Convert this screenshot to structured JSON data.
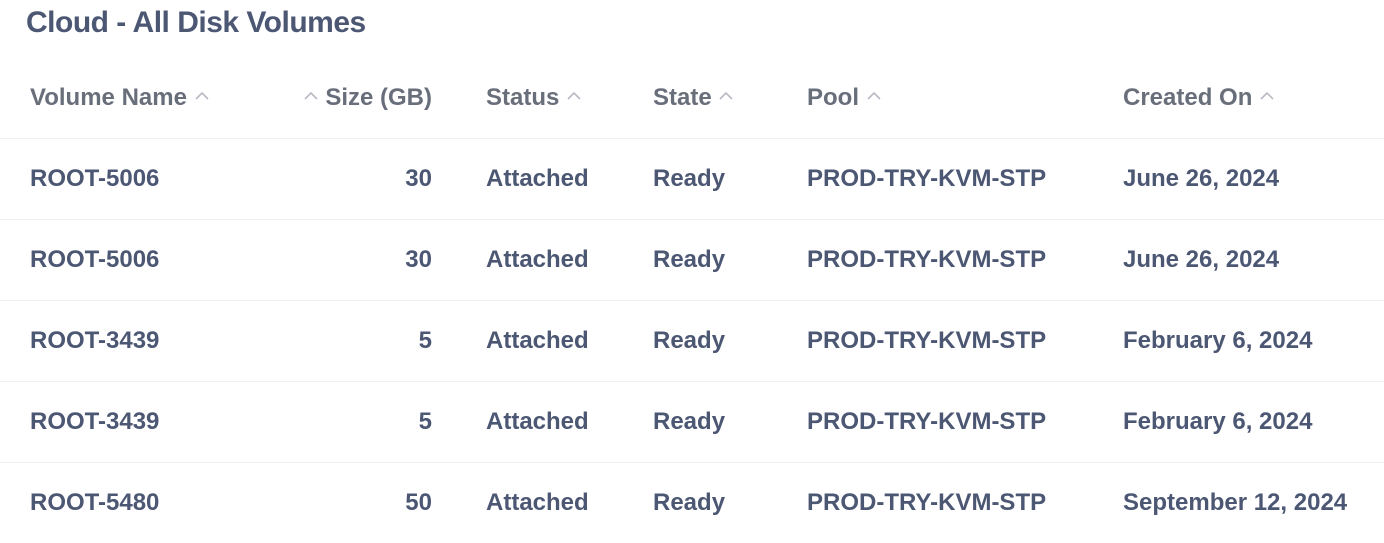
{
  "page": {
    "title": "Cloud - All Disk Volumes"
  },
  "table": {
    "headers": {
      "volume_name": "Volume Name",
      "size": "Size (GB)",
      "status": "Status",
      "state": "State",
      "pool": "Pool",
      "created_on": "Created On"
    },
    "rows": [
      {
        "volume_name": "ROOT-5006",
        "size": "30",
        "status": "Attached",
        "state": "Ready",
        "pool": "PROD-TRY-KVM-STP",
        "created_on": "June 26, 2024"
      },
      {
        "volume_name": "ROOT-5006",
        "size": "30",
        "status": "Attached",
        "state": "Ready",
        "pool": "PROD-TRY-KVM-STP",
        "created_on": "June 26, 2024"
      },
      {
        "volume_name": "ROOT-3439",
        "size": "5",
        "status": "Attached",
        "state": "Ready",
        "pool": "PROD-TRY-KVM-STP",
        "created_on": "February 6, 2024"
      },
      {
        "volume_name": "ROOT-3439",
        "size": "5",
        "status": "Attached",
        "state": "Ready",
        "pool": "PROD-TRY-KVM-STP",
        "created_on": "February 6, 2024"
      },
      {
        "volume_name": "ROOT-5480",
        "size": "50",
        "status": "Attached",
        "state": "Ready",
        "pool": "PROD-TRY-KVM-STP",
        "created_on": "September 12, 2024"
      }
    ]
  },
  "icons": {
    "sort": "chevron-up-icon"
  },
  "colors": {
    "text": "#4c5773",
    "header_text": "#696e7b",
    "sort_icon": "#b8bbc3",
    "row_divider": "#eef0f2",
    "background": "#ffffff"
  }
}
